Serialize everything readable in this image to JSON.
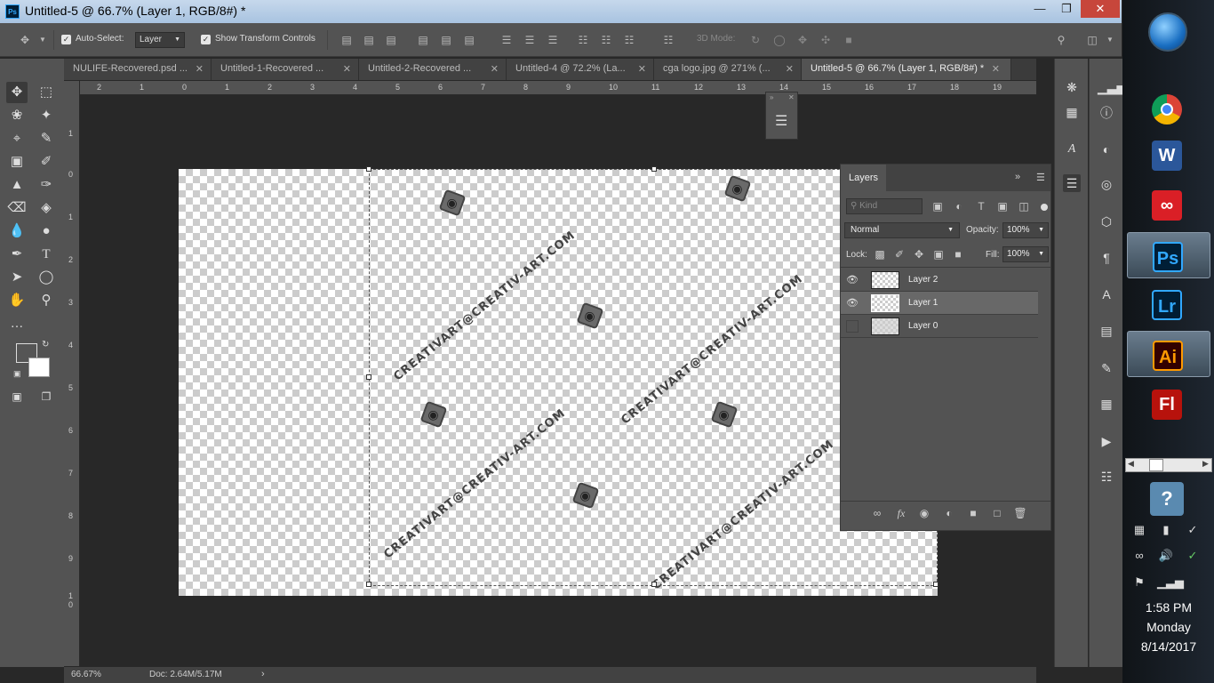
{
  "window": {
    "title": "Untitled-5 @ 66.7% (Layer 1, RGB/8#) *",
    "app_badge": "Ps"
  },
  "options": {
    "auto_select_label": "Auto-Select:",
    "auto_select_value": "Layer",
    "show_transform_label": "Show Transform Controls",
    "mode_3d_label": "3D Mode:"
  },
  "tabs": [
    {
      "label": "NULIFE-Recovered.psd ..."
    },
    {
      "label": "Untitled-1-Recovered ..."
    },
    {
      "label": "Untitled-2-Recovered ..."
    },
    {
      "label": "Untitled-4 @ 72.2% (La..."
    },
    {
      "label": "cga logo.jpg @ 271% (..."
    },
    {
      "label": "Untitled-5 @ 66.7% (Layer 1, RGB/8#) *"
    }
  ],
  "ruler_top": [
    "2",
    "1",
    "0",
    "1",
    "2",
    "3",
    "4",
    "5",
    "6",
    "7",
    "8",
    "9",
    "10",
    "11",
    "12",
    "13",
    "14",
    "15",
    "16",
    "17",
    "18",
    "19"
  ],
  "ruler_left": [
    "1",
    "0",
    "1",
    "2",
    "3",
    "4",
    "5",
    "6",
    "7",
    "8",
    "9",
    "1",
    "0"
  ],
  "canvas": {
    "watermark_text": "CREATIVART@CREATIV-ART.COM"
  },
  "layers_panel": {
    "title": "Layers",
    "filter_placeholder": "Kind",
    "blend_mode": "Normal",
    "opacity_label": "Opacity:",
    "opacity_value": "100%",
    "lock_label": "Lock:",
    "fill_label": "Fill:",
    "fill_value": "100%",
    "layers": [
      {
        "name": "Layer 2",
        "visible": true,
        "active": false
      },
      {
        "name": "Layer 1",
        "visible": true,
        "active": true
      },
      {
        "name": "Layer 0",
        "visible": false,
        "active": false
      }
    ]
  },
  "status": {
    "zoom": "66.67%",
    "doc": "Doc: 2.64M/5.17M"
  },
  "taskbar": {
    "apps": [
      {
        "name": "chrome",
        "label": "",
        "bg": "#ffffff",
        "fg": "#dd4b39"
      },
      {
        "name": "word",
        "label": "W",
        "bg": "#2b579a",
        "fg": "#ffffff"
      },
      {
        "name": "creative-cloud",
        "label": "∞",
        "bg": "#da1f26",
        "fg": "#ffffff"
      },
      {
        "name": "photoshop",
        "label": "Ps",
        "bg": "#001e36",
        "fg": "#31a8ff"
      },
      {
        "name": "lightroom",
        "label": "Lr",
        "bg": "#001d34",
        "fg": "#31a8ff"
      },
      {
        "name": "illustrator",
        "label": "Ai",
        "bg": "#330000",
        "fg": "#ff9a00"
      },
      {
        "name": "flash",
        "label": "Fl",
        "bg": "#b7120c",
        "fg": "#ffffff"
      }
    ],
    "time": "1:58 PM",
    "day": "Monday",
    "date": "8/14/2017"
  }
}
